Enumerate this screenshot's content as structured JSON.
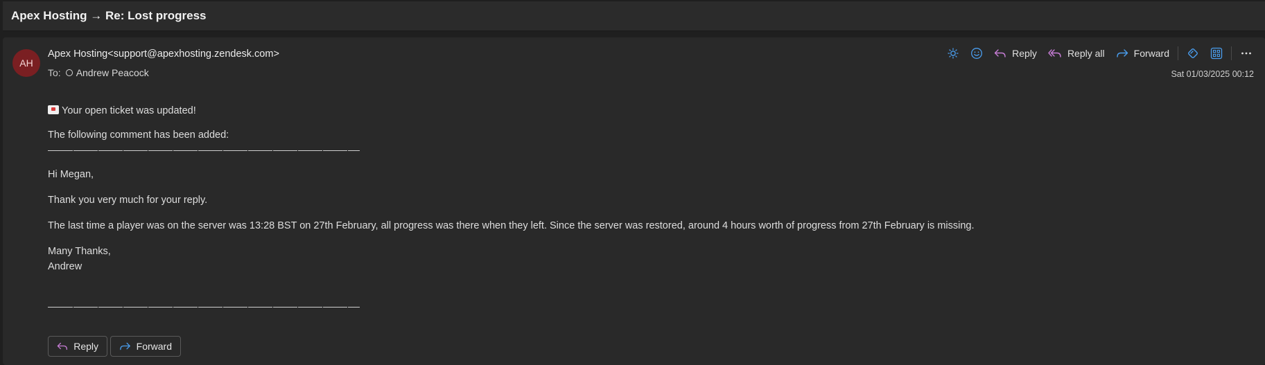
{
  "window": {
    "title": "Apex Hosting → Re: Lost progress"
  },
  "message": {
    "avatar_initials": "AH",
    "from": "Apex Hosting<support@apexhosting.zendesk.com>",
    "to_label": "To:",
    "to_name": "Andrew Peacock",
    "datetime": "Sat 01/03/2025 00:12"
  },
  "toolbar": {
    "reply_label": "Reply",
    "reply_all_label": "Reply all",
    "forward_label": "Forward"
  },
  "body": {
    "notice": "Your open ticket was updated!",
    "comment_intro": "The following comment has been added:",
    "greeting": "Hi Megan,",
    "paragraph1": "Thank you very much for your reply.",
    "paragraph2": "The last time a player was on the server was 13:28 BST on 27th February, all progress was there when they left. Since the server was restored, around 4 hours worth of progress from 27th February is missing.",
    "signoff": "Many Thanks,",
    "signature": "Andrew"
  },
  "footer": {
    "reply_label": "Reply",
    "forward_label": "Forward"
  },
  "colors": {
    "reply_icon": "#c77dd6",
    "forward_icon": "#4a9eef",
    "accent": "#4a9eef",
    "avatar_bg": "#7a1f22"
  }
}
